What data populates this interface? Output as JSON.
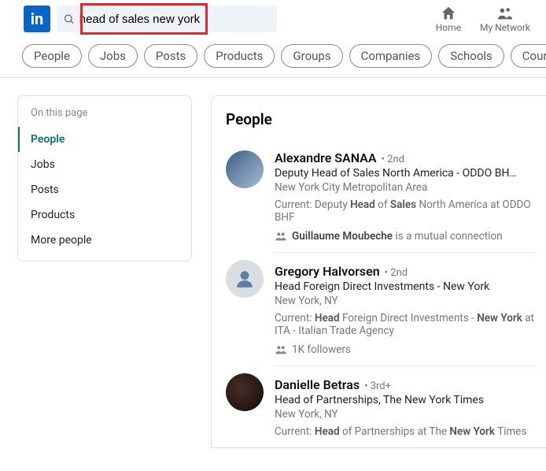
{
  "search": {
    "query": "head of sales new york"
  },
  "topnav": {
    "home": "Home",
    "network": "My Network"
  },
  "filters": [
    "People",
    "Jobs",
    "Posts",
    "Products",
    "Groups",
    "Companies",
    "Schools",
    "Cour"
  ],
  "sidebar": {
    "title": "On this page",
    "items": [
      "People",
      "Jobs",
      "Posts",
      "Products",
      "More people"
    ],
    "active": 0
  },
  "results": {
    "heading": "People",
    "people": [
      {
        "name": "Alexandre SANAA",
        "degree": "• 2nd",
        "headline_underlined": "Deputy Head of Sales",
        "headline_rest": " North America - ODDO BH…",
        "location": "New York City Metropolitan Area",
        "current_pre": "Current: Deputy ",
        "current_b1": "Head",
        "current_mid": " of ",
        "current_b2": "Sales",
        "current_post": " North America at ODDO BHF",
        "meta_name": "Guillaume Moubeche",
        "meta_text": " is a mutual connection"
      },
      {
        "name": "Gregory Halvorsen",
        "degree": "• 2nd",
        "headline": "Head Foreign Direct Investments - New York",
        "location": "New York, NY",
        "current_pre": "Current: ",
        "current_b1": "Head",
        "current_mid": " Foreign Direct Investments - ",
        "current_b2": "New York",
        "current_post": " at ITA - Italian Trade Agency",
        "meta_text": "1K followers"
      },
      {
        "name": "Danielle Betras",
        "degree": "• 3rd+",
        "headline": "Head of Partnerships, The New York Times",
        "location": "New York, NY",
        "current_pre": "Current: ",
        "current_b1": "Head",
        "current_mid": " of Partnerships at The ",
        "current_b2": "New York",
        "current_post": " Times"
      }
    ]
  }
}
